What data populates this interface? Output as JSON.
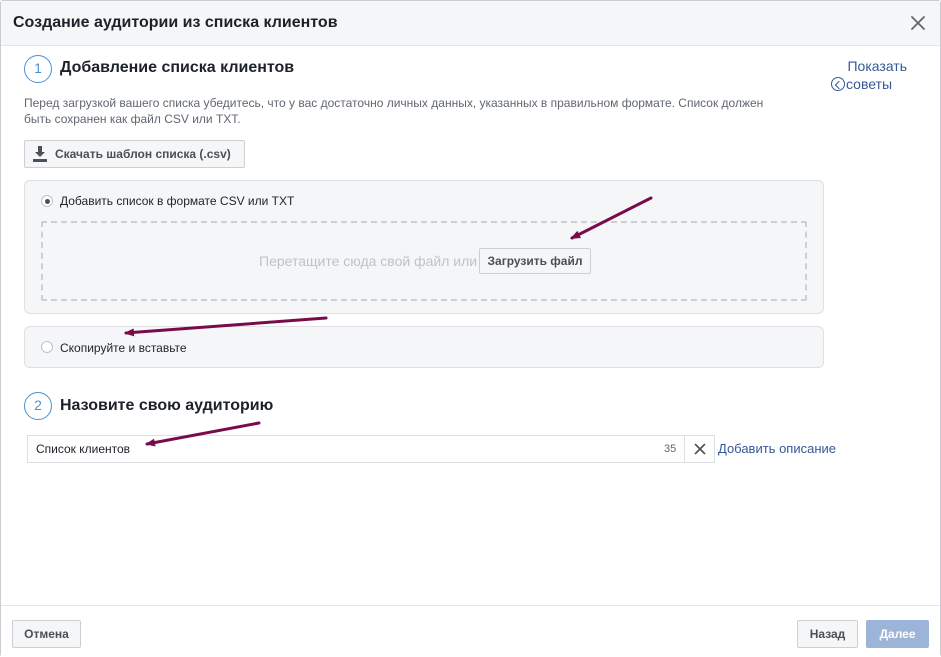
{
  "dialog": {
    "title": "Создание аудитории из списка клиентов"
  },
  "tips": {
    "line1": "Показать",
    "line2": "советы"
  },
  "step1": {
    "number": "1",
    "title": "Добавление списка клиентов",
    "description": "Перед загрузкой вашего списка убедитесь, что у вас достаточно личных данных, указанных в правильном формате. Список должен быть сохранен как файл CSV или TXT.",
    "download_label": "Скачать шаблон списка (.csv)",
    "option_file_label": "Добавить список в формате CSV или TXT",
    "dropzone_text": "Перетащите сюда свой файл или",
    "upload_label": "Загрузить файл",
    "option_paste_label": "Скопируйте и вставьте"
  },
  "step2": {
    "number": "2",
    "title": "Назовите свою аудиторию",
    "name_value": "Список клиентов",
    "counter": "35",
    "add_description_label": "Добавить описание"
  },
  "footer": {
    "cancel_label": "Отмена",
    "back_label": "Назад",
    "next_label": "Далее"
  },
  "colors": {
    "accent": "#4a90d9",
    "link": "#365899",
    "annotation_arrow": "#7a0b4a",
    "next_disabled": "#9cb4d8"
  }
}
